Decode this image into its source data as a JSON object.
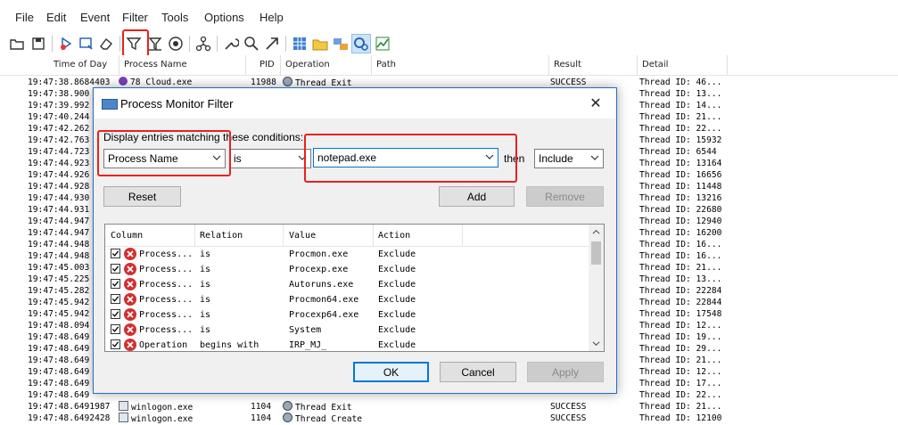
{
  "menu": [
    "File",
    "Edit",
    "Event",
    "Filter",
    "Tools",
    "Options",
    "Help"
  ],
  "toolbar_icons": [
    "open-icon",
    "save-icon",
    "capture-icon",
    "autoscroll-icon",
    "clear-icon",
    "filter-icon",
    "highlight-icon",
    "target-icon",
    "process-tree-icon",
    "properties-icon",
    "find-icon",
    "jump-icon",
    "registry-icon",
    "filesystem-icon",
    "network-icon",
    "process-activity-icon",
    "profiling-icon"
  ],
  "columns": {
    "time": "Time of Day",
    "process": "Process Name",
    "pid": "PID",
    "operation": "Operation",
    "path": "Path",
    "result": "Result",
    "detail": "Detail"
  },
  "rows": [
    {
      "time": "19:47:38.8684403",
      "proc": "78 Cloud.exe",
      "pid": "11988",
      "op": "Thread Exit",
      "result": "SUCCESS",
      "detail": "Thread ID: 46..."
    },
    {
      "time": "19:47:38.900",
      "detail": "Thread ID: 13..."
    },
    {
      "time": "19:47:39.992",
      "detail": "Thread ID: 14..."
    },
    {
      "time": "19:47:40.244",
      "detail": "Thread ID: 21..."
    },
    {
      "time": "19:47:42.262",
      "detail": "Thread ID: 22..."
    },
    {
      "time": "19:47:42.763",
      "detail": "Thread ID: 15932"
    },
    {
      "time": "19:47:44.723",
      "detail": "Thread ID: 6544"
    },
    {
      "time": "19:47:44.923",
      "detail": "Thread ID: 13164"
    },
    {
      "time": "19:47:44.926",
      "detail": "Thread ID: 16656"
    },
    {
      "time": "19:47:44.928",
      "detail": "Thread ID: 11448"
    },
    {
      "time": "19:47:44.930",
      "detail": "Thread ID: 13216"
    },
    {
      "time": "19:47:44.931",
      "detail": "Thread ID: 22680"
    },
    {
      "time": "19:47:44.947",
      "detail": "Thread ID: 12940"
    },
    {
      "time": "19:47:44.947",
      "detail": "Thread ID: 16200"
    },
    {
      "time": "19:47:44.948",
      "detail": "Thread ID: 16..."
    },
    {
      "time": "19:47:44.948",
      "detail": "Thread ID: 16..."
    },
    {
      "time": "19:47:45.003",
      "detail": "Thread ID: 21..."
    },
    {
      "time": "19:47:45.225",
      "detail": "Thread ID: 13..."
    },
    {
      "time": "19:47:45.282",
      "detail": "Thread ID: 22284"
    },
    {
      "time": "19:47:45.942",
      "detail": "Thread ID: 22844"
    },
    {
      "time": "19:47:45.942",
      "detail": "Thread ID: 17548"
    },
    {
      "time": "19:47:48.094",
      "detail": "Thread ID: 12..."
    },
    {
      "time": "19:47:48.649",
      "detail": "Thread ID: 19..."
    },
    {
      "time": "19:47:48.649",
      "detail": "Thread ID: 29..."
    },
    {
      "time": "19:47:48.649",
      "detail": "Thread ID: 21..."
    },
    {
      "time": "19:47:48.649",
      "detail": "Thread ID: 12..."
    },
    {
      "time": "19:47:48.649",
      "detail": "Thread ID: 17..."
    },
    {
      "time": "19:47:48.649",
      "detail": "Thread ID: 22..."
    },
    {
      "time": "19:47:48.6491987",
      "proc": "winlogon.exe",
      "pid": "1104",
      "op": "Thread Exit",
      "result": "SUCCESS",
      "detail": "Thread ID: 21..."
    },
    {
      "time": "19:47:48.6492428",
      "proc": "winlogon.exe",
      "pid": "1104",
      "op": "Thread Create",
      "result": "SUCCESS",
      "detail": "Thread ID: 12100"
    }
  ],
  "dialog": {
    "title": "Process Monitor Filter",
    "instructions": "Display entries matching these conditions:",
    "column_value": "Process Name",
    "relation_value": "is",
    "value_value": "notepad.exe",
    "then_label": "then",
    "action_value": "Include",
    "reset_label": "Reset",
    "add_label": "Add",
    "remove_label": "Remove",
    "ok_label": "OK",
    "cancel_label": "Cancel",
    "apply_label": "Apply",
    "list_headers": {
      "column": "Column",
      "relation": "Relation",
      "value": "Value",
      "action": "Action"
    },
    "rules": [
      {
        "column": "Process...",
        "relation": "is",
        "value": "Procmon.exe",
        "action": "Exclude"
      },
      {
        "column": "Process...",
        "relation": "is",
        "value": "Procexp.exe",
        "action": "Exclude"
      },
      {
        "column": "Process...",
        "relation": "is",
        "value": "Autoruns.exe",
        "action": "Exclude"
      },
      {
        "column": "Process...",
        "relation": "is",
        "value": "Procmon64.exe",
        "action": "Exclude"
      },
      {
        "column": "Process...",
        "relation": "is",
        "value": "Procexp64.exe",
        "action": "Exclude"
      },
      {
        "column": "Process...",
        "relation": "is",
        "value": "System",
        "action": "Exclude"
      },
      {
        "column": "Operation",
        "relation": "begins with",
        "value": "IRP_MJ_",
        "action": "Exclude"
      }
    ]
  },
  "colors": {
    "highlight_red": "#e8211e",
    "accent_blue": "#0078d7",
    "error_red": "#d32f2f"
  }
}
